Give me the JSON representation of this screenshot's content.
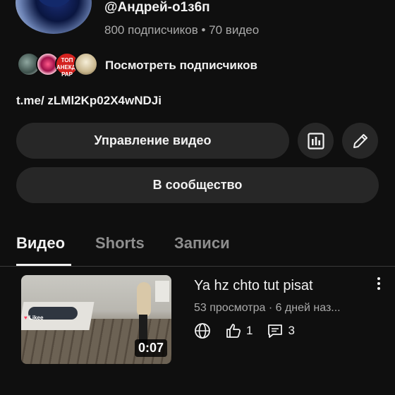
{
  "channel": {
    "handle": "@Андрей-о1з6п",
    "stats": "800 подписчиков • 70 видео",
    "view_subscribers_label": "Посмотреть подписчиков",
    "link": "t.me/ zLMl2Kp02X4wNDJi",
    "subscriber_avatar3_text": "ТОП АНЕКДОТ PAP"
  },
  "actions": {
    "manage_videos_label": "Управление видео",
    "community_label": "В сообщество"
  },
  "tabs": [
    {
      "label": "Видео",
      "active": true
    },
    {
      "label": "Shorts",
      "active": false
    },
    {
      "label": "Записи",
      "active": false
    }
  ],
  "videos": [
    {
      "title": "Ya hz chto tut pisat",
      "meta": "53 просмотра · 6 дней наз...",
      "duration": "0:07",
      "likes": "1",
      "comments": "3",
      "watermark": "Likee"
    }
  ],
  "colors": {
    "background": "#0f0f0f",
    "button": "#272727",
    "text_primary": "#f1f1f1",
    "text_secondary": "#aaaaaa"
  },
  "icons": [
    "stats-icon",
    "pencil-icon",
    "globe-icon",
    "thumb-up-icon",
    "comment-icon",
    "more-vert-icon"
  ]
}
